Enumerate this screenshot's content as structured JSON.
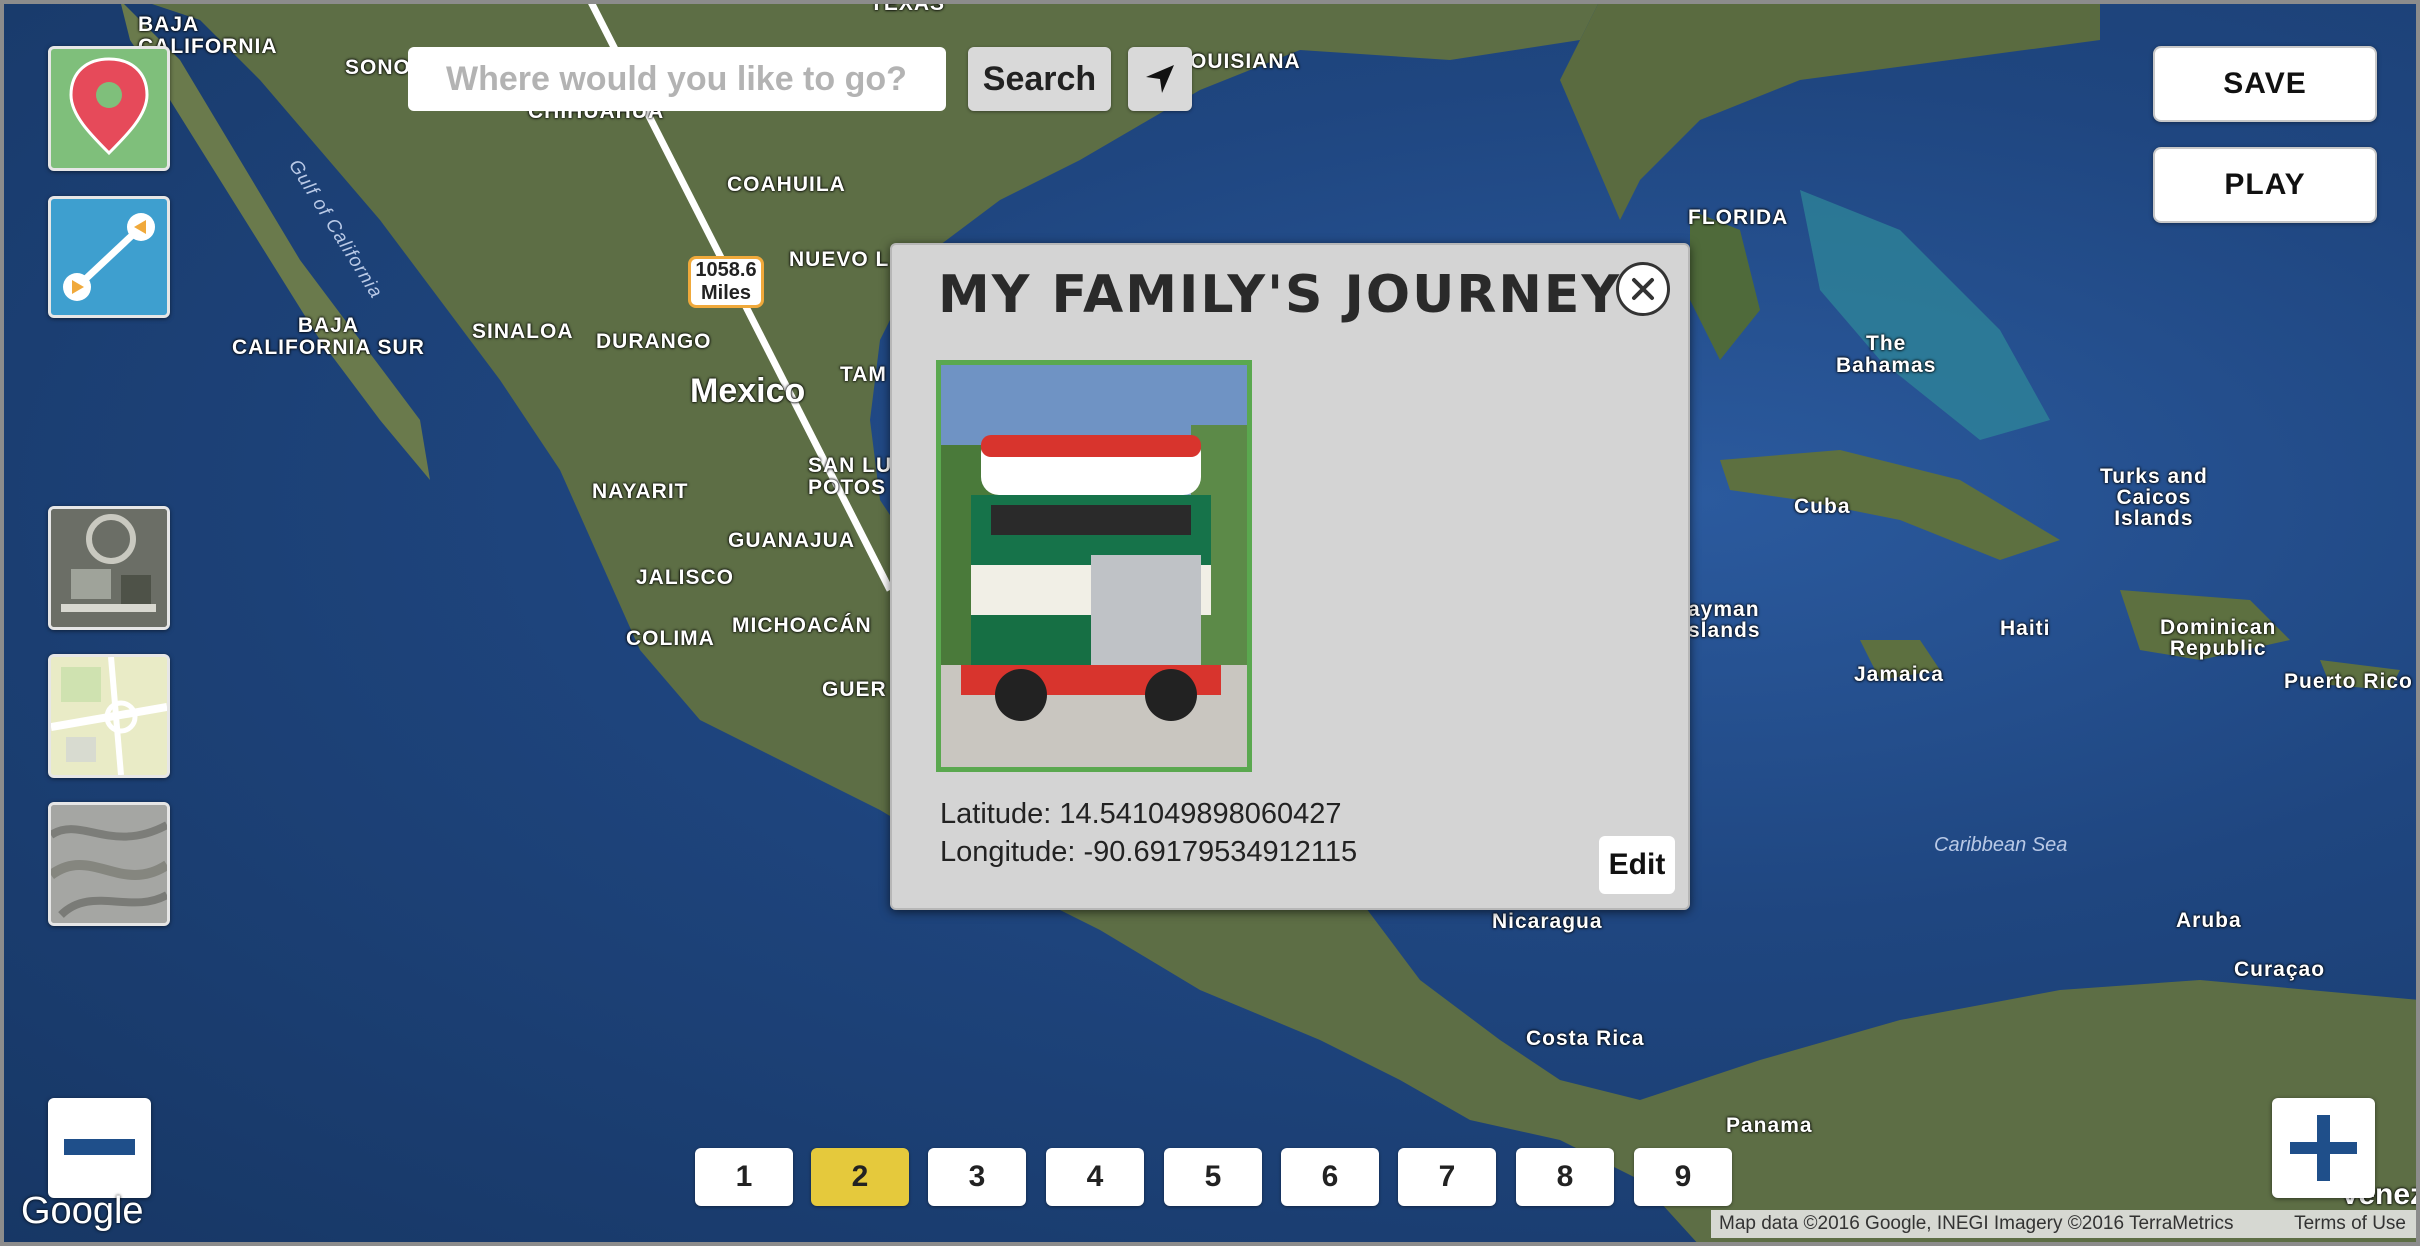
{
  "map": {
    "labels": {
      "baja_california": "BAJA\nCALIFORNIA",
      "sonora": "SONO",
      "chihuahua": "CHIHUAHUA",
      "coahuila": "COAHUILA",
      "nuevo_leon": "NUEVO L",
      "sinaloa": "SINALOA",
      "durango": "DURANGO",
      "baja_california_sur": "BAJA\nCALIFORNIA SUR",
      "mexico": "Mexico",
      "tamaulipas": "TAM",
      "san_luis_potosi": "SAN LU\nPOTOS",
      "nayarit": "NAYARIT",
      "guanajuato": "GUANAJUA",
      "jalisco": "JALISCO",
      "colima": "COLIMA",
      "michoacan": "MICHOACÁN",
      "guerrero": "GUER",
      "gulf_of_california": "Gulf of California",
      "texas": "TEXAS",
      "louisiana": "OUISIANA",
      "florida": "FLORIDA",
      "bahamas": "The\nBahamas",
      "cuba": "Cuba",
      "turks_caicos": "Turks and\nCaicos\nIslands",
      "cayman": "ayman\nslands",
      "haiti": "Haiti",
      "dominican_republic": "Dominican\nRepublic",
      "jamaica": "Jamaica",
      "puerto_rico": "Puerto Rico",
      "caribbean_sea": "Caribbean Sea",
      "nicaragua": "Nicaragua",
      "costa_rica": "Costa Rica",
      "panama": "Panama",
      "aruba": "Aruba",
      "curacao": "Curaçao",
      "venezuela": "Venez"
    },
    "distance_marker": {
      "value": "1058.6",
      "unit": "Miles"
    }
  },
  "search": {
    "placeholder": "Where would you like to go?",
    "button_label": "Search",
    "locate_icon": "navigation-arrow-icon"
  },
  "tools": {
    "pin_icon": "map-pin-icon",
    "route_icon": "route-line-icon",
    "map_types": [
      "satellite",
      "roadmap",
      "terrain"
    ]
  },
  "actions": {
    "save_label": "SAVE",
    "play_label": "PLAY"
  },
  "popup": {
    "title": "MY FAMILY'S JOURNEY",
    "latitude_text": "Latitude: 14.541049898060427",
    "longitude_text": "Longitude: -90.69179534912115",
    "edit_label": "Edit",
    "close_icon": "close-icon"
  },
  "pager": {
    "pages": [
      "1",
      "2",
      "3",
      "4",
      "5",
      "6",
      "7",
      "8",
      "9"
    ],
    "active": "2"
  },
  "zoom": {
    "out_icon": "minus-icon",
    "in_icon": "plus-icon"
  },
  "footer": {
    "logo": "Google",
    "attribution": "Map data ©2016 Google, INEGI Imagery ©2016 TerraMetrics",
    "terms": "Terms of Use"
  },
  "colors": {
    "active_page": "#e5c93c",
    "photo_border": "#5aa84f",
    "route_line": "#ffffff",
    "distance_border": "#f0a93b"
  }
}
